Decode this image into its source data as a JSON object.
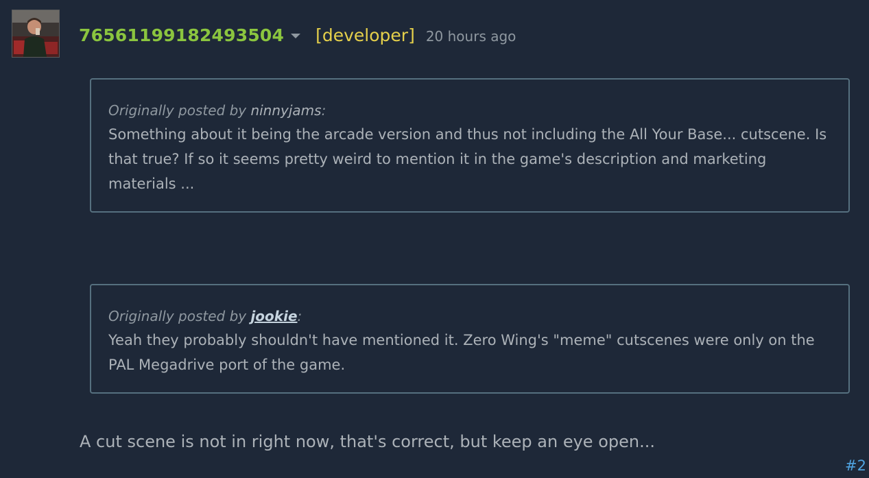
{
  "post": {
    "author_name": "76561199182493504",
    "developer_tag": "[developer]",
    "timestamp": "20 hours ago",
    "quotes": [
      {
        "prefix": "Originally posted by ",
        "author": "ninnyjams",
        "suffix": ":",
        "body": "Something about it being the arcade version and thus not including the All Your Base... cutscene. Is that true? If so it seems pretty weird to mention it in the game's description and marketing materials ..."
      },
      {
        "prefix": "Originally posted by ",
        "author": "jookie",
        "suffix": ":",
        "body": "Yeah they probably shouldn't have mentioned it. Zero Wing's \"meme\" cutscenes were only on the PAL Megadrive port of the game."
      }
    ],
    "reply_text": "A cut scene is not in right now, that's correct, but keep an eye open...",
    "post_number": "#2"
  },
  "icons": {
    "author_menu": "chevron-down-icon",
    "avatar": "user-avatar"
  },
  "colors": {
    "background": "#1e2838",
    "author_name": "#8bc53f",
    "developer_tag": "#e5d04b",
    "quote_border": "#56707f",
    "post_number": "#4fa3e0"
  }
}
